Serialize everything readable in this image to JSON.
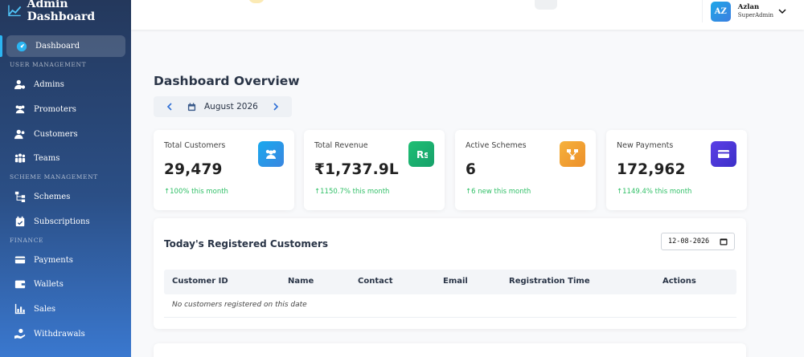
{
  "sidebar": {
    "brand": "Admin Dashboard",
    "active": {
      "label": "Dashboard",
      "icon": "gauge-icon"
    },
    "sections": {
      "user_management": "USER MANAGEMENT",
      "scheme_management": "SCHEME MANAGEMENT",
      "finance": "FINANCE"
    },
    "items": {
      "admins": {
        "label": "Admins",
        "icon": "user-gear-icon"
      },
      "promoters": {
        "label": "Promoters",
        "icon": "users-icon"
      },
      "customers": {
        "label": "Customers",
        "icon": "user-group-icon"
      },
      "teams": {
        "label": "Teams",
        "icon": "people-group-icon"
      },
      "schemes": {
        "label": "Schemes",
        "icon": "sitemap-icon"
      },
      "subscriptions": {
        "label": "Subscriptions",
        "icon": "calendar-check-icon"
      },
      "payments": {
        "label": "Payments",
        "icon": "credit-card-icon"
      },
      "wallets": {
        "label": "Wallets",
        "icon": "wallet-icon"
      },
      "sales": {
        "label": "Sales",
        "icon": "chart-bar-icon"
      },
      "withdrawals": {
        "label": "Withdrawals",
        "icon": "hand-holding-icon"
      }
    }
  },
  "topbar": {
    "user": {
      "initials": "AZ",
      "name": "Azlan",
      "role": "SuperAdmin"
    }
  },
  "main": {
    "title": "Dashboard Overview",
    "month": "August 2026",
    "cards": [
      {
        "title": "Total Customers",
        "value": "29,479",
        "change": "↑100% this month",
        "icon": "users-icon",
        "color": "#1e9bea"
      },
      {
        "title": "Total Revenue",
        "value": "₹1,737.9L",
        "change": "↑1150.7% this month",
        "icon": "rupee-icon",
        "color": "#22b36f"
      },
      {
        "title": "Active Schemes",
        "value": "6",
        "change": "↑6 new this month",
        "icon": "sitemap-icon",
        "color": "#f0a12e"
      },
      {
        "title": "New Payments",
        "value": "172,962",
        "change": "↑1149.4% this month",
        "icon": "credit-card-icon",
        "color": "#4a3fe0"
      }
    ],
    "registered": {
      "title": "Today's Registered Customers",
      "date": "12-08-2026",
      "columns": [
        "Customer ID",
        "Name",
        "Contact",
        "Email",
        "Registration Time",
        "Actions"
      ],
      "empty": "No customers registered on this date"
    }
  }
}
